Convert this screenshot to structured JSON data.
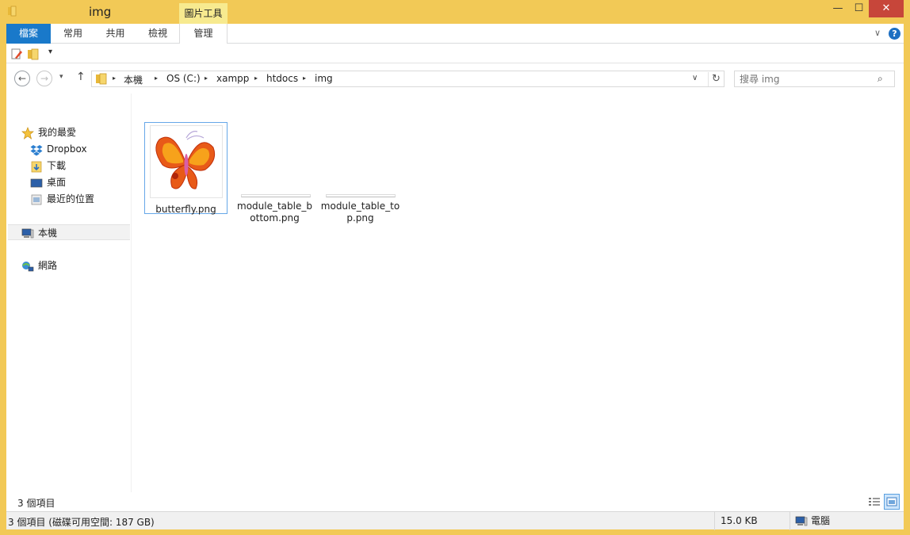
{
  "window": {
    "title": "img",
    "contextual_tab": "圖片工具",
    "minimize": "—",
    "maximize": "☐",
    "close": "✕"
  },
  "ribbon": {
    "tabs": [
      "檔案",
      "常用",
      "共用",
      "檢視",
      "管理"
    ],
    "expand_glyph": "∨",
    "help_glyph": "?"
  },
  "quick_access": {
    "dropdown_glyph": "▾"
  },
  "address": {
    "back_glyph": "←",
    "forward_glyph": "→",
    "recent_glyph": "▾",
    "up_glyph": "↑",
    "path": [
      "本機",
      "OS (C:)",
      "xampp",
      "htdocs",
      "img"
    ],
    "separator": "▸",
    "dropdown_glyph": "∨",
    "refresh_glyph": "↻"
  },
  "search": {
    "placeholder": "搜尋 img",
    "icon_glyph": "⌕"
  },
  "nav": {
    "favorites": "我的最愛",
    "dropbox": "Dropbox",
    "downloads": "下載",
    "desktop": "桌面",
    "recent": "最近的位置",
    "this_pc": "本機",
    "network": "網路"
  },
  "files": [
    {
      "name": "butterfly.png",
      "selected": true
    },
    {
      "name": "module_table_bottom.png",
      "selected": false
    },
    {
      "name": "module_table_top.png",
      "selected": false
    }
  ],
  "status": {
    "item_count": "3 個項目",
    "details": "3 個項目 (磁碟可用空間: 187 GB)",
    "size": "15.0 KB",
    "location": "電腦"
  },
  "colors": {
    "frame": "#f2c956",
    "file_tab": "#1979ca",
    "contextual_tab": "#f7ea8f",
    "close_button": "#c7463a",
    "selection_border": "#66a7e8"
  }
}
